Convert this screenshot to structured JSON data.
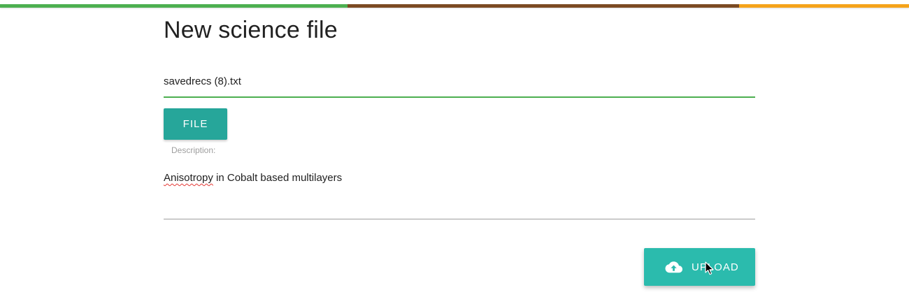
{
  "theme": {
    "bar_colors": [
      "#4caf50",
      "#7b4a22",
      "#f5a31a"
    ],
    "accent_teal": "#26a69a",
    "accent_teal_light": "#2bbbad",
    "field_active_underline": "#4caf50"
  },
  "page": {
    "title": "New science file"
  },
  "file_input": {
    "value": "savedrecs (8).txt",
    "button_label": "FILE"
  },
  "description": {
    "label": "Description:",
    "value_word1": "Anisotropy",
    "value_rest": " in Cobalt based multilayers"
  },
  "actions": {
    "upload_label": "UPLOAD",
    "upload_icon": "cloud-upload-icon"
  },
  "cursor": {
    "icon": "mouse-pointer-icon"
  }
}
